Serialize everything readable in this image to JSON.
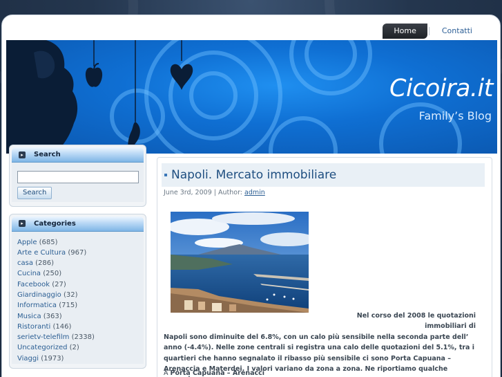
{
  "nav": {
    "items": [
      {
        "label": "Home",
        "active": true
      },
      {
        "label": "Contatti",
        "active": false
      }
    ]
  },
  "header": {
    "title": "Cicoira.it",
    "tagline": "Family’s Blog",
    "colors": {
      "banner": "#0f6fd3",
      "ring": "#6ebeff"
    }
  },
  "sidebar": {
    "search": {
      "title": "Search",
      "button_label": "Search",
      "value": ""
    },
    "categories": {
      "title": "Categories",
      "items": [
        {
          "name": "Apple",
          "count": "(685)"
        },
        {
          "name": "Arte e Cultura",
          "count": "(967)"
        },
        {
          "name": "casa",
          "count": "(286)"
        },
        {
          "name": "Cucina",
          "count": "(250)"
        },
        {
          "name": "Facebook",
          "count": "(27)"
        },
        {
          "name": "Giardinaggio",
          "count": "(32)"
        },
        {
          "name": "Informatica",
          "count": "(715)"
        },
        {
          "name": "Musica",
          "count": "(363)"
        },
        {
          "name": "Ristoranti",
          "count": "(146)"
        },
        {
          "name": "serietv-telefilm",
          "count": "(2338)"
        },
        {
          "name": "Uncategorized",
          "count": "(2)"
        },
        {
          "name": "Viaggi",
          "count": "(1973)"
        }
      ]
    }
  },
  "post": {
    "title": "Napoli. Mercato immobiliare",
    "date": "June 3rd, 2009",
    "meta_sep": " | Author: ",
    "author": "admin",
    "text_first": "Nel corso del 2008 le quotazioni immobiliari di",
    "text_rest": "Napoli sono diminuite del 6.8%, con un calo più sensibile nella seconda parte dell’ anno (-4.4%). Nelle zone centrali si registra una calo delle quotazioni del 5.1%, tra i quartieri che hanno segnalato il ribasso più sensibile ci sono Porta Capuana – Arenaccia e Materdei. I valori variano da zona a zona. Ne riportiamo qualche esempio.",
    "sub_prefix": "A ",
    "sub_bold": "Porta Capuana – Arenacci"
  }
}
